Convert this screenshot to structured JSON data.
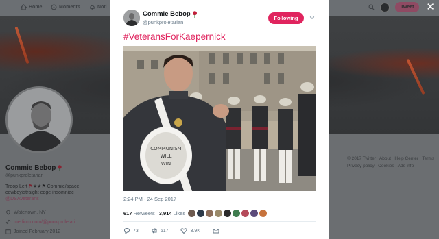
{
  "nav": {
    "home": "Home",
    "moments": "Moments",
    "notifications": "Noti",
    "tweet_button": "Tweet"
  },
  "profile": {
    "name": "Commie Bebop",
    "handle": "@punkproletarian",
    "bio_line1": "Troop Left ",
    "bio_line1_rest": " Commie/space",
    "bio_line2": "cowboy/straight edge insomniac",
    "bio_link": "@DSAVeterans",
    "location": "Watertown, NY",
    "website": "medium.com/@punkproletari...",
    "joined": "Joined February 2012"
  },
  "footer": {
    "line1": [
      "© 2017 Twitter",
      "About",
      "Help Center",
      "Terms"
    ],
    "line2": [
      "Privacy policy",
      "Cookies",
      "Ads info"
    ]
  },
  "tweet": {
    "author_name": "Commie Bebop",
    "author_handle": "@punkproletarian",
    "follow_label": "Following",
    "text": "#VeteransForKaepernick",
    "hat_text_1": "COMMUNISM",
    "hat_text_2": "WILL",
    "hat_text_3": "WIN",
    "timestamp": "2:24 PM - 24 Sep 2017",
    "retweets_count": "617",
    "retweets_label": "Retweets",
    "likes_count": "3,914",
    "likes_label": "Likes",
    "reply_count": "73",
    "retweet_action_count": "617",
    "like_action_count": "3.9K"
  },
  "colors": {
    "accent": "#e0245e",
    "text": "#14171a",
    "secondary": "#657786"
  },
  "icons": [
    "home-icon",
    "moments-icon",
    "bell-icon",
    "search-icon",
    "close-icon",
    "chevron-down-icon",
    "reply-icon",
    "retweet-icon",
    "heart-icon",
    "envelope-icon",
    "rose-icon",
    "location-icon",
    "link-icon",
    "calendar-icon"
  ]
}
